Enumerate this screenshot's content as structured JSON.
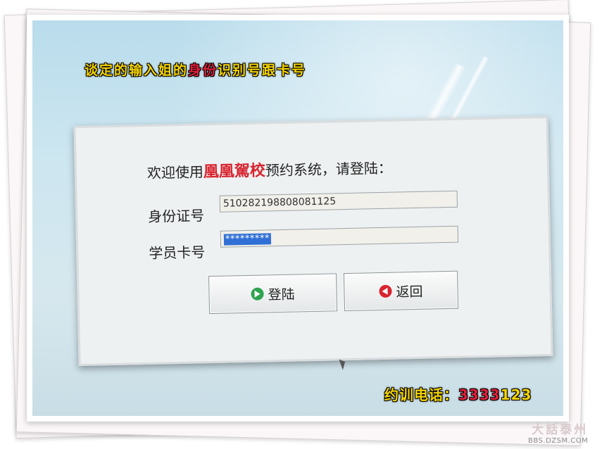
{
  "caption_top": {
    "part1": "谈定的输入姐的",
    "part2": "身份",
    "part3": "识别号跟卡号"
  },
  "dialog": {
    "welcome_prefix": "欢迎使用",
    "brand": "凰凰駕校",
    "welcome_suffix": "预约系统，请登陆：",
    "id_label": "身份证号",
    "id_value": "510282198808081125",
    "card_label": "学员卡号",
    "card_value": "*********",
    "login_button": "登陆",
    "back_button": "返回"
  },
  "caption_bottom": {
    "prefix": "约训电话：",
    "highlight": "3333",
    "suffix": "123"
  },
  "watermark": {
    "logo": "大話泰州",
    "url": "BBS.DZSM.COM"
  },
  "colors": {
    "caption_yellow": "#f5d400",
    "brand_red": "#d8242f",
    "selection_blue": "#2f6fd6"
  }
}
